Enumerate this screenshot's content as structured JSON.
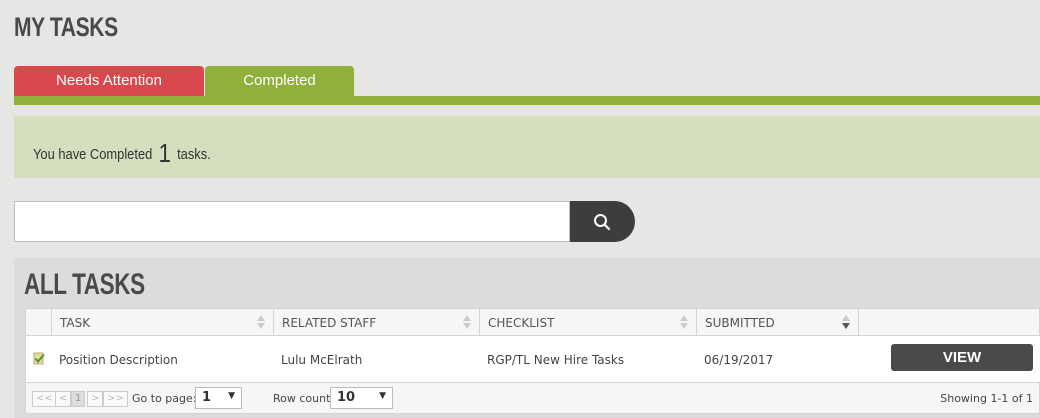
{
  "header": {
    "title": "MY TASKS"
  },
  "tabs": [
    {
      "label": "Needs Attention",
      "color": "#d9484c"
    },
    {
      "label": "Completed",
      "color": "#8fb03a",
      "active": true
    }
  ],
  "notice": {
    "prefix": "You have Completed",
    "count": "1",
    "suffix": "tasks."
  },
  "search": {
    "value": "",
    "placeholder": "",
    "icon": "search-icon"
  },
  "section": {
    "title": "ALL TASKS"
  },
  "table": {
    "columns": [
      "TASK",
      "RELATED STAFF",
      "CHECKLIST",
      "SUBMITTED"
    ],
    "rows": [
      {
        "icon": "checked-document-icon",
        "task": "Position Description",
        "related_staff": "Lulu McElrath",
        "checklist": "RGP/TL New Hire Tasks",
        "submitted": "06/19/2017",
        "action": "VIEW"
      }
    ]
  },
  "pager": {
    "first": "<<",
    "prev": "<",
    "current_page": "1",
    "next": ">",
    "last": ">>",
    "goto_label": "Go to page:",
    "goto_value": "1",
    "rowcount_label": "Row count:",
    "rowcount_value": "10",
    "showing": "Showing 1-1 of 1"
  }
}
